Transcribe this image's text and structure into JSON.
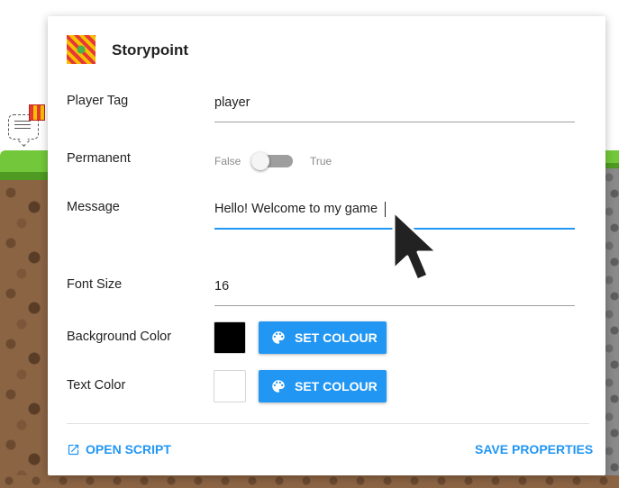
{
  "dialog": {
    "title": "Storypoint",
    "fields": {
      "player_tag": {
        "label": "Player Tag",
        "value": "player"
      },
      "permanent": {
        "label": "Permanent",
        "false_label": "False",
        "true_label": "True",
        "value": false
      },
      "message": {
        "label": "Message",
        "value": "Hello! Welcome to my game"
      },
      "font_size": {
        "label": "Font Size",
        "value": "16"
      },
      "background_color": {
        "label": "Background Color",
        "value": "#000000",
        "button_label": "SET COLOUR"
      },
      "text_color": {
        "label": "Text Color",
        "value": "#ffffff",
        "button_label": "SET COLOUR"
      }
    },
    "footer": {
      "open_script_label": "OPEN SCRIPT",
      "save_properties_label": "SAVE PROPERTIES"
    }
  },
  "colors": {
    "accent": "#2196f3",
    "grass": "#72c83a",
    "dirt": "#8b6444"
  },
  "icons": {
    "header": "storypoint-sprite-icon",
    "palette": "palette-icon",
    "open_script": "open-external-icon",
    "cursor": "mouse-pointer-icon"
  }
}
